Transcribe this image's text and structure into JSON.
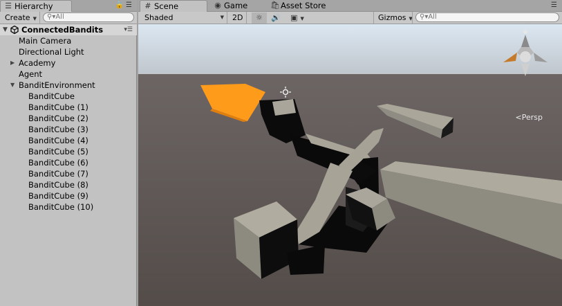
{
  "hierarchy": {
    "tab_label": "Hierarchy",
    "create_label": "Create",
    "search_placeholder": "All",
    "scene_name": "ConnectedBandits",
    "items": [
      {
        "label": "Main Camera",
        "level": 1,
        "arrow": ""
      },
      {
        "label": "Directional Light",
        "level": 1,
        "arrow": ""
      },
      {
        "label": "Academy",
        "level": 1,
        "arrow": "collapsed"
      },
      {
        "label": "Agent",
        "level": 1,
        "arrow": ""
      },
      {
        "label": "BanditEnvironment",
        "level": 1,
        "arrow": "expanded"
      },
      {
        "label": "BanditCube",
        "level": 2,
        "arrow": ""
      },
      {
        "label": "BanditCube (1)",
        "level": 2,
        "arrow": ""
      },
      {
        "label": "BanditCube (2)",
        "level": 2,
        "arrow": ""
      },
      {
        "label": "BanditCube (3)",
        "level": 2,
        "arrow": ""
      },
      {
        "label": "BanditCube (4)",
        "level": 2,
        "arrow": ""
      },
      {
        "label": "BanditCube (5)",
        "level": 2,
        "arrow": ""
      },
      {
        "label": "BanditCube (6)",
        "level": 2,
        "arrow": ""
      },
      {
        "label": "BanditCube (7)",
        "level": 2,
        "arrow": ""
      },
      {
        "label": "BanditCube (8)",
        "level": 2,
        "arrow": ""
      },
      {
        "label": "BanditCube (9)",
        "level": 2,
        "arrow": ""
      },
      {
        "label": "BanditCube (10)",
        "level": 2,
        "arrow": ""
      }
    ]
  },
  "tabs": {
    "scene": "Scene",
    "game": "Game",
    "asset_store": "Asset Store"
  },
  "scene_toolbar": {
    "shading_mode": "Shaded",
    "mode_2d": "2D",
    "gizmos": "Gizmos",
    "search_placeholder": "All"
  },
  "viewport": {
    "projection_label": "Persp",
    "colors": {
      "sky_top": "#d9e5f0",
      "horizon": "#bfc5cc",
      "ground": "#5a5350",
      "highlight": "#ff9b1a",
      "cube_face": "#a8a598",
      "cube_shadow": "#0a0a0a"
    }
  }
}
